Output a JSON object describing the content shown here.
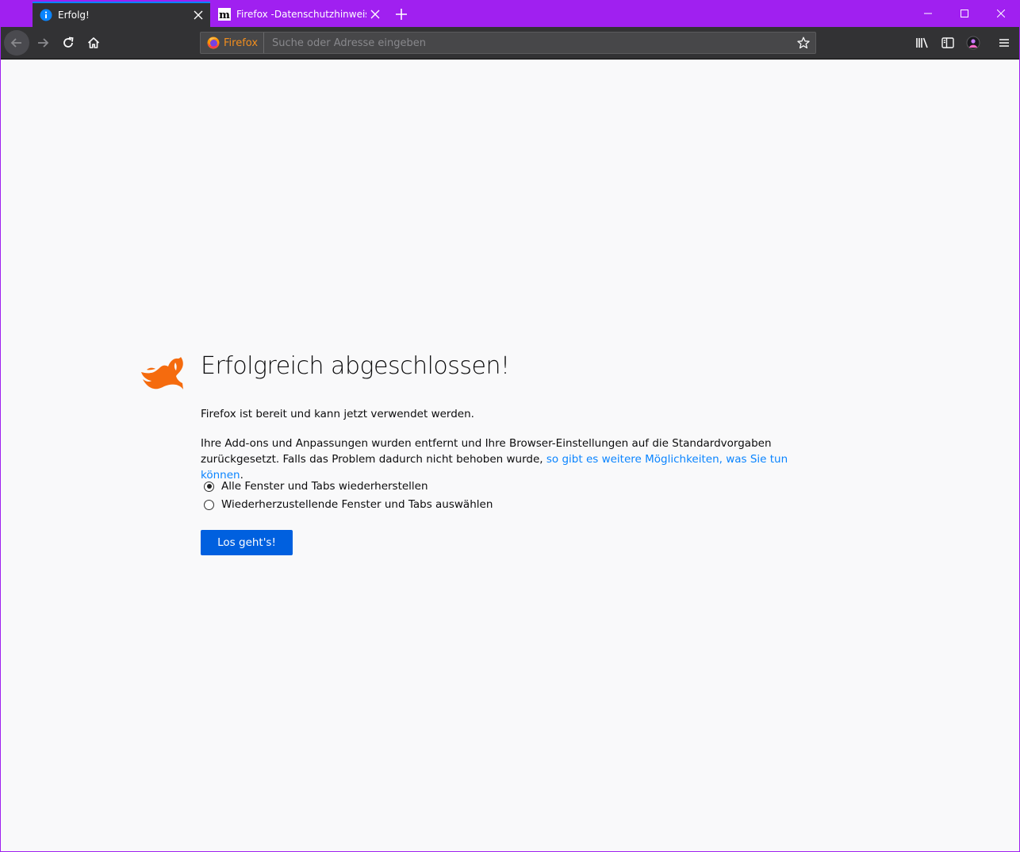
{
  "tabs": [
    {
      "label": "Erfolg!",
      "icon": "info-icon",
      "active": true
    },
    {
      "label": "Firefox -Datenschutzhinweis —",
      "icon": "m-favicon-icon",
      "active": false
    }
  ],
  "urlbar": {
    "identity_label": "Firefox",
    "placeholder": "Suche oder Adresse eingeben"
  },
  "page": {
    "title": "Erfolgreich abgeschlossen!",
    "ready_text": "Firefox ist bereit und kann jetzt verwendet werden.",
    "reset_text": "Ihre Add-ons und Anpassungen wurden entfernt und Ihre Browser-Einstellungen auf die Standardvorgaben zurückgesetzt. Falls das Problem dadurch nicht behoben wurde, ",
    "link_text": "so gibt es weitere Möglichkeiten, was Sie tun können",
    "after_link": ".",
    "options": [
      {
        "label": "Alle Fenster und Tabs wiederherstellen",
        "checked": true
      },
      {
        "label": "Wiederherzustellende Fenster und Tabs auswählen",
        "checked": false
      }
    ],
    "button_label": "Los geht's!"
  },
  "colors": {
    "titlebar": "#a020f0",
    "toolbar": "#323234",
    "accent": "#0060df",
    "link": "#0a84ff",
    "fox": "#f56b0e"
  }
}
